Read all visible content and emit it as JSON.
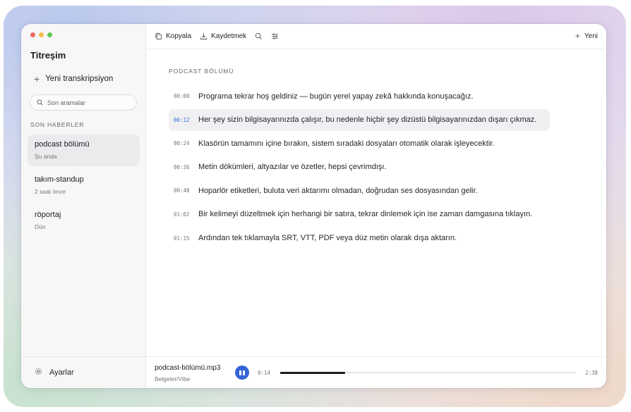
{
  "app": {
    "title": "Titreşim"
  },
  "sidebar": {
    "new_transcription": "Yeni transkripsiyon",
    "search_placeholder": "Son aramalar",
    "section_label": "SON HABERLER",
    "items": [
      {
        "title": "podcast bölümü",
        "subtitle": "Şu anda",
        "active": true
      },
      {
        "title": "takım-standup",
        "subtitle": "2 saat önce",
        "active": false
      },
      {
        "title": "röportaj",
        "subtitle": "Dün",
        "active": false
      }
    ],
    "settings_label": "Ayarlar"
  },
  "toolbar": {
    "copy_label": "Kopyala",
    "save_label": "Kaydetmek",
    "new_label": "Yeni"
  },
  "transcript": {
    "section_label": "PODCAST BÖLÜMÜ",
    "rows": [
      {
        "time": "00:00",
        "text": "Programa tekrar hoş geldiniz — bugün yerel yapay zekâ hakkında konuşacağız."
      },
      {
        "time": "00:12",
        "text": "Her şey sizin bilgisayarınızda çalışır, bu nedenle hiçbir şey dizüstü bilgisayarınızdan dışarı çıkmaz."
      },
      {
        "time": "00:24",
        "text": "Klasörün tamamını içine bırakın, sistem sıradaki dosyaları otomatik olarak işleyecektir."
      },
      {
        "time": "00:36",
        "text": "Metin dökümleri, altyazılar ve özetler, hepsi çevrimdışı."
      },
      {
        "time": "00:48",
        "text": "Hoparlör etiketleri, buluta veri aktarımı olmadan, doğrudan ses dosyasından gelir."
      },
      {
        "time": "01:02",
        "text": "Bir kelimeyi düzeltmek için herhangi bir satıra, tekrar dinlemek için ise zaman damgasına tıklayın."
      },
      {
        "time": "01:15",
        "text": "Ardından tek tıklamayla SRT, VTT, PDF veya düz metin olarak dışa aktarın."
      }
    ],
    "active_index": 1
  },
  "player": {
    "file_name": "podcast-bölümü.mp3",
    "file_path": "Belgeler/Vibe",
    "current_time": "0:14",
    "total_time": "2:38",
    "progress_fraction": 0.22,
    "accent_color": "#3566d6"
  },
  "colors": {
    "traffic_red": "#ee6a5f",
    "traffic_yellow": "#f5be4f",
    "traffic_green": "#62c655"
  },
  "icons": [
    "plus-icon",
    "search-icon",
    "copy-icon",
    "download-icon",
    "sliders-icon",
    "gear-icon",
    "pause-icon"
  ]
}
